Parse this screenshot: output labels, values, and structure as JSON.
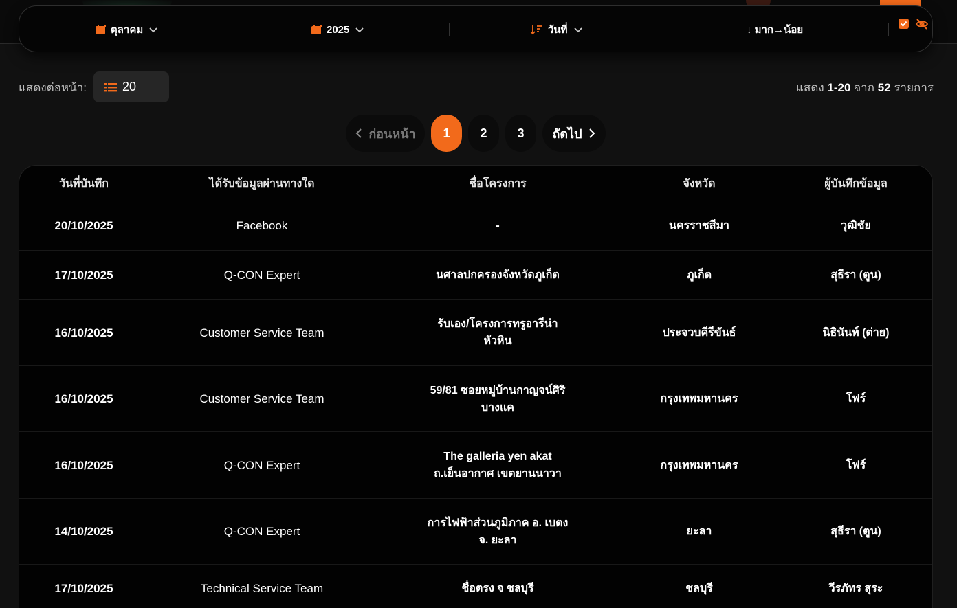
{
  "filters": {
    "month": "ตุลาคม",
    "year": "2025",
    "sort_field": "วันที่",
    "sort_order": "↓ มาก→น้อย"
  },
  "per_page": {
    "label": "แสดงต่อหน้า:",
    "value": "20"
  },
  "summary": {
    "prefix": "แสดง",
    "range": "1-20",
    "from": "จาก",
    "total": "52",
    "suffix": "รายการ"
  },
  "pagination": {
    "prev": "ก่อนหน้า",
    "pages": [
      "1",
      "2",
      "3"
    ],
    "current": "1",
    "next": "ถัดไป"
  },
  "table": {
    "headers": [
      "วันที่บันทึก",
      "ได้รับข้อมูลผ่านทางใด",
      "ชื่อโครงการ",
      "จังหวัด",
      "ผู้บันทึกข้อมูล"
    ],
    "rows": [
      {
        "date": "20/10/2025",
        "channel": "Facebook",
        "project": "-",
        "province": "นครราชสีมา",
        "recorder": "วุฒิชัย"
      },
      {
        "date": "17/10/2025",
        "channel": "Q-CON Expert",
        "project": "นศาลปกครองจังหวัดภูเก็ต",
        "province": "ภูเก็ต",
        "recorder": "สุธีรา (ตูน)"
      },
      {
        "date": "16/10/2025",
        "channel": "Customer Service Team",
        "project": "รับเอง/โครงการทรูอารีน่า หัวหิน",
        "province": "ประจวบคีรีขันธ์",
        "recorder": "นิธินันท์ (ต่าย)"
      },
      {
        "date": "16/10/2025",
        "channel": "Customer Service Team",
        "project": "59/81 ซอยหมู่บ้านกาญจน์ศิริ บางแค",
        "province": "กรุงเทพมหานคร",
        "recorder": "โฟร์"
      },
      {
        "date": "16/10/2025",
        "channel": "Q-CON Expert",
        "project": "The galleria yen akat ถ.เย็นอากาศ เขตยานนาวา",
        "province": "กรุงเทพมหานคร",
        "recorder": "โฟร์"
      },
      {
        "date": "14/10/2025",
        "channel": "Q-CON Expert",
        "project": "การไฟฟ้าส่วนภูมิภาค อ. เบตง จ. ยะลา",
        "province": "ยะลา",
        "recorder": "สุธีรา (ตูน)"
      },
      {
        "date": "17/10/2025",
        "channel": "Technical Service Team",
        "project": "ชื่อตรง จ ชลบุรี",
        "province": "ชลบุรี",
        "recorder": "วีรภัทร สุระ"
      }
    ]
  },
  "colors": {
    "accent": "#f26a1b",
    "background": "#111111",
    "panel": "#050505"
  }
}
